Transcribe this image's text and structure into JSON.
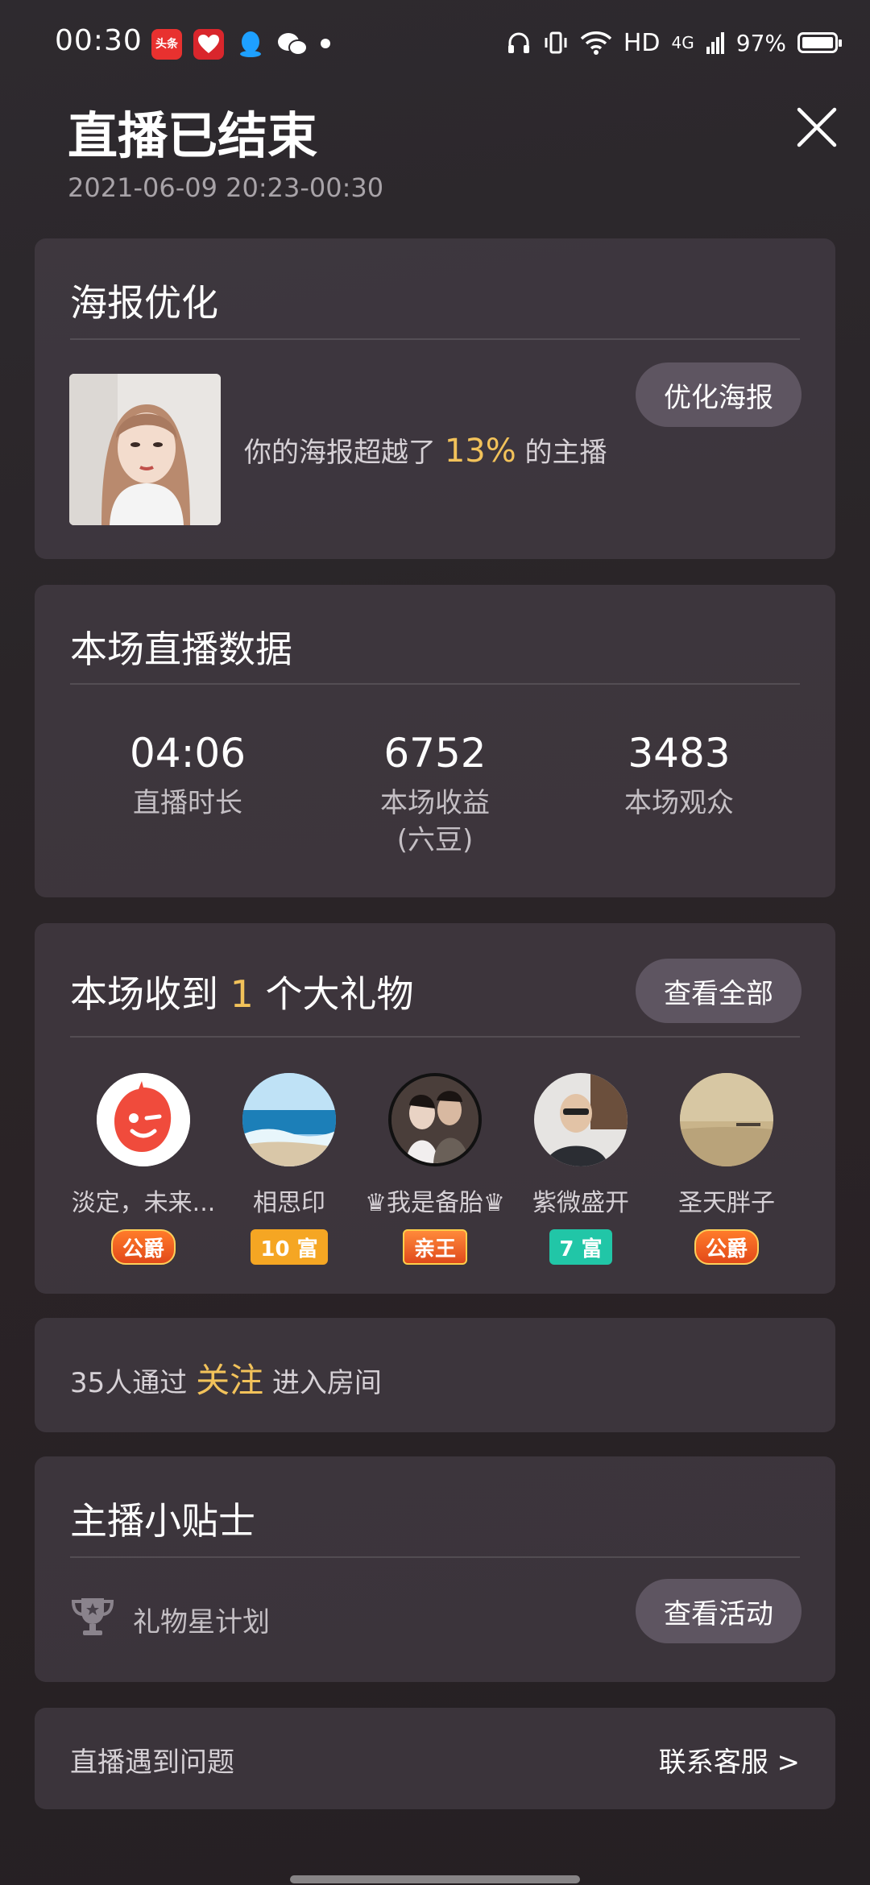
{
  "status_bar": {
    "time": "00:30",
    "app_icons": [
      "toutiao-icon",
      "heart-app-icon",
      "qq-icon",
      "wechat-icon"
    ],
    "toutiao_label": "头条",
    "hd_label": "HD",
    "network_label": "4G",
    "battery_text": "97%"
  },
  "header": {
    "title": "直播已结束",
    "subtitle": "2021-06-09 20:23-00:30"
  },
  "poster": {
    "title": "海报优化",
    "text_prefix": "你的海报超越了 ",
    "percent": "13%",
    "text_suffix": " 的主播",
    "button_label": "优化海报"
  },
  "stats": {
    "title": "本场直播数据",
    "items": [
      {
        "value": "04:06",
        "label": "直播时长",
        "sublabel": ""
      },
      {
        "value": "6752",
        "label": "本场收益",
        "sublabel": "(六豆)"
      },
      {
        "value": "3483",
        "label": "本场观众",
        "sublabel": ""
      }
    ]
  },
  "gifts": {
    "title_prefix": "本场收到 ",
    "count": "1",
    "title_suffix": " 个大礼物",
    "button_label": "查看全部",
    "gifters": [
      {
        "name": "淡定，未来...",
        "badge": "公爵"
      },
      {
        "name": "相思印",
        "badge": "10 富"
      },
      {
        "name": "♛我是备胎♛",
        "badge": "亲王"
      },
      {
        "name": "紫微盛开",
        "badge": "7 富"
      },
      {
        "name": "圣天胖子",
        "badge": "公爵"
      }
    ]
  },
  "follow": {
    "prefix": "35人通过 ",
    "highlight": "关注",
    "suffix": " 进入房间"
  },
  "tips": {
    "title": "主播小贴士",
    "item_label": "礼物星计划",
    "button_label": "查看活动"
  },
  "help": {
    "text": "直播遇到问题",
    "link_label": "联系客服 >"
  },
  "colors": {
    "accent": "#f2c25a",
    "card_bg": "#48414a",
    "button_bg": "#5e5561"
  }
}
